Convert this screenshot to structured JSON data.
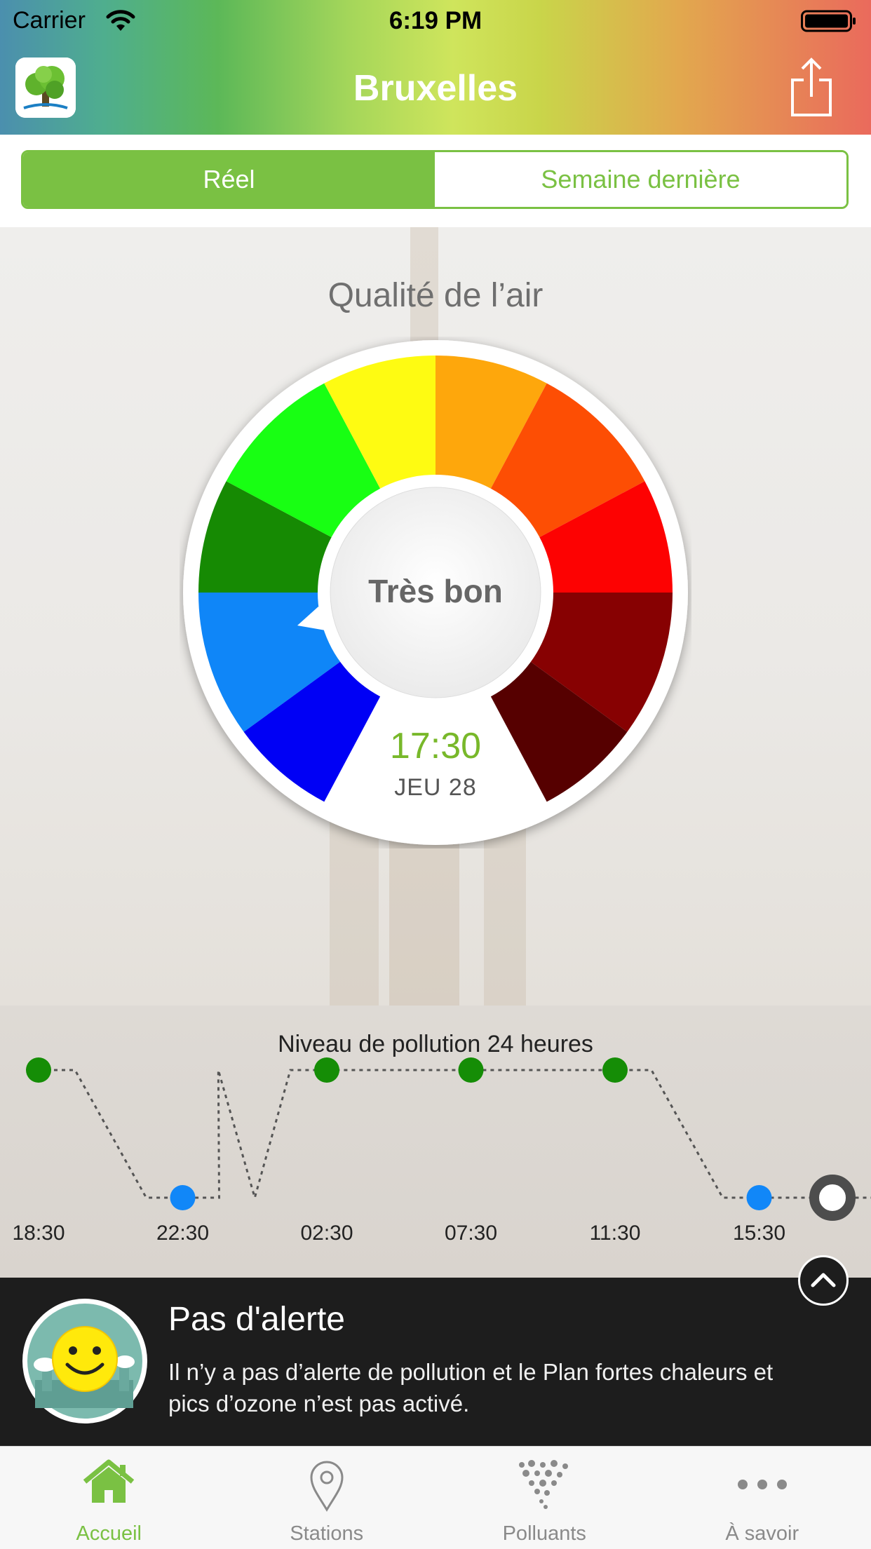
{
  "status_bar": {
    "carrier": "Carrier",
    "time": "6:19 PM"
  },
  "header": {
    "title": "Bruxelles"
  },
  "segments": {
    "active": "Réel",
    "inactive": "Semaine dernière"
  },
  "main": {
    "section_title": "Qualité de l’air",
    "quality_label": "Très bon",
    "time": "17:30",
    "day": "JEU 28"
  },
  "gauge_colors": [
    "#0f86f8",
    "#0000f5",
    "#168a03",
    "#18ff13",
    "#fefb12",
    "#fea70c",
    "#fd4e04",
    "#fd0202",
    "#870102",
    "#560000"
  ],
  "chart_data": {
    "type": "line",
    "title": "Niveau de pollution 24 heures",
    "categories": [
      "18:30",
      "22:30",
      "02:30",
      "07:30",
      "11:30",
      "15:30"
    ],
    "series": [
      {
        "values": [
          4,
          2,
          4,
          4,
          4,
          2,
          2
        ]
      }
    ],
    "markers": [
      {
        "time": "18:30",
        "color": "#158d06"
      },
      {
        "time": "22:30",
        "color": "#1187f8"
      },
      {
        "time": "02:30",
        "color": "#158d06"
      },
      {
        "time": "07:30",
        "color": "#158d06"
      },
      {
        "time": "11:30",
        "color": "#158d06"
      },
      {
        "time": "15:30",
        "color": "#1187f8"
      }
    ],
    "grid": false,
    "legend": "none"
  },
  "alert": {
    "title": "Pas d'alerte",
    "text": "Il n’y a pas d’alerte de pollution et le Plan fortes chaleurs et pics d’ozone n’est pas activé."
  },
  "tabs": [
    {
      "label": "Accueil",
      "icon": "home-icon",
      "active": true
    },
    {
      "label": "Stations",
      "icon": "map-pin-icon",
      "active": false
    },
    {
      "label": "Polluants",
      "icon": "particles-icon",
      "active": false
    },
    {
      "label": "À savoir",
      "icon": "more-dots-icon",
      "active": false
    }
  ],
  "colors": {
    "accent": "#7ac143",
    "alert_bg": "#1d1d1d"
  }
}
